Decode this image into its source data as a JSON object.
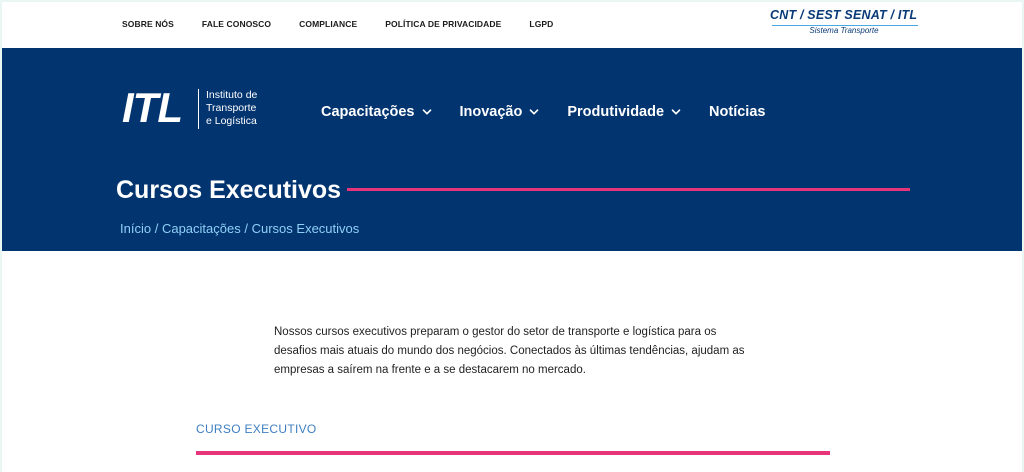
{
  "topbar": {
    "links": [
      {
        "label": "SOBRE NÓS"
      },
      {
        "label": "FALE CONOSCO"
      },
      {
        "label": "COMPLIANCE"
      },
      {
        "label": "POLÍTICA DE PRIVACIDADE"
      },
      {
        "label": "LGPD"
      }
    ],
    "partner_logo": {
      "main_text": "CNT / SEST SENAT / ITL",
      "sub_text": "Sistema Transporte"
    }
  },
  "header": {
    "logo": {
      "mark": "ITL",
      "line1": "Instituto de",
      "line2": "Transporte",
      "line3": "e Logística"
    },
    "nav": [
      {
        "label": "Capacitações",
        "has_dropdown": true,
        "icon": "chevron-down-icon"
      },
      {
        "label": "Inovação",
        "has_dropdown": true,
        "icon": "chevron-down-icon"
      },
      {
        "label": "Produtividade",
        "has_dropdown": true,
        "icon": "chevron-down-icon"
      },
      {
        "label": "Notícias",
        "has_dropdown": false
      }
    ]
  },
  "hero": {
    "title": "Cursos Executivos",
    "breadcrumb": {
      "home": "Início",
      "parent": "Capacitações",
      "current": "Cursos Executivos",
      "separator": "/"
    }
  },
  "content": {
    "intro_line1": "Nossos cursos executivos preparam o gestor do setor de transporte e logística para os",
    "intro_line2": "desafios mais atuais do mundo dos negócios. Conectados às últimas tendências, ajudam as",
    "intro_line3": "empresas a saírem na frente e a se destacarem no mercado.",
    "section_label": "CURSO EXECUTIVO"
  },
  "colors": {
    "brand_blue": "#023470",
    "accent_pink": "#e8347a",
    "breadcrumb_blue": "#8fd0f7",
    "section_label_blue": "#3f7fc2"
  }
}
